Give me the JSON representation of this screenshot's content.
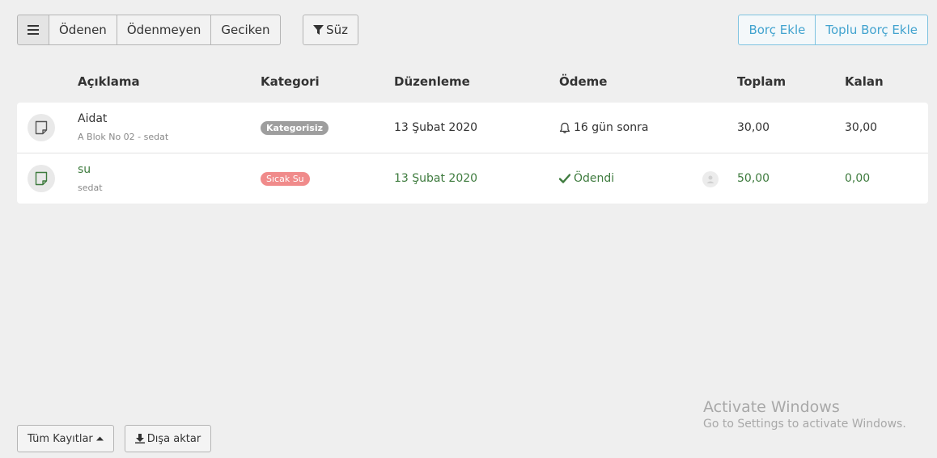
{
  "toolbar": {
    "filters": [
      "Ödenen",
      "Ödenmeyen",
      "Geciken"
    ],
    "menu_icon": "hamburger-icon",
    "filter_label": "Süz",
    "add_debt": "Borç Ekle",
    "bulk_add_debt": "Toplu Borç Ekle"
  },
  "table": {
    "headers": {
      "description": "Açıklama",
      "category": "Kategori",
      "edited": "Düzenleme",
      "payment": "Ödeme",
      "total": "Toplam",
      "remaining": "Kalan"
    },
    "rows": [
      {
        "title": "Aidat",
        "subtitle": "A Blok No 02 - sedat",
        "category": "Kategorisiz",
        "date": "13 Şubat 2020",
        "payment": "16 gün sonra",
        "payment_icon": "bell-icon",
        "total": "30,00",
        "remaining": "30,00"
      },
      {
        "title": "su",
        "subtitle": "sedat",
        "category": "Sıcak Su",
        "date": "13 Şubat 2020",
        "payment": "Ödendi",
        "payment_icon": "check-icon",
        "total": "50,00",
        "remaining": "0,00"
      }
    ]
  },
  "footer": {
    "all_records": "Tüm Kayıtlar",
    "export": "Dışa aktar"
  },
  "watermark": {
    "title": "Activate Windows",
    "subtitle": "Go to Settings to activate Windows."
  },
  "colors": {
    "accent": "#42a3cf",
    "paid_green": "#3e7b3e",
    "badge_red": "#f08b8b",
    "badge_gray": "#9e9e9e"
  }
}
